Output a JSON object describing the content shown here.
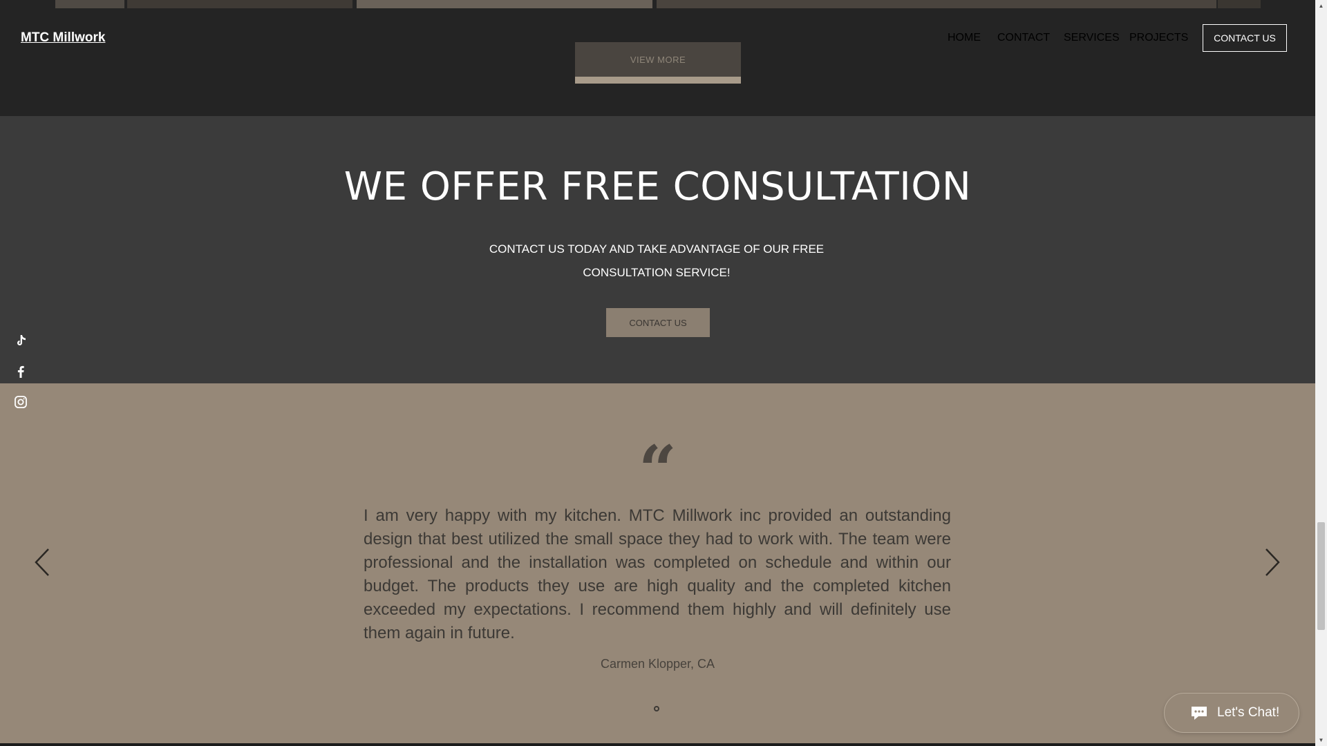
{
  "header": {
    "brand": "MTC Millwork",
    "nav": [
      "HOME",
      "CONTACT",
      "SERVICES",
      "PROJECTS"
    ],
    "cta": "CONTACT US"
  },
  "projects": {
    "view_more": "VIEW MORE"
  },
  "consultation": {
    "title": "WE OFFER FREE CONSULTATION",
    "subtitle_line1": "CONTACT US TODAY AND TAKE ADVANTAGE OF OUR FREE",
    "subtitle_line2": "CONSULTATION SERVICE!",
    "button": "CONTACT US"
  },
  "social": {
    "icons": [
      "tiktok-icon",
      "facebook-icon",
      "instagram-icon"
    ]
  },
  "testimonial": {
    "quote_mark": "“",
    "text": "I am very happy with my kitchen. MTC Millwork inc provided an outstanding design that best utilized the small space they had to work with. The team were professional and the installation was completed on schedule and within our budget. The products they use are high quality and the completed kitchen exceeded my expectations. I recommend them highly and will definitely use them again in future.",
    "author": "Carmen Klopper, CA"
  },
  "chat": {
    "label": "Let's Chat!"
  },
  "colors": {
    "dark": "#242424",
    "section_gray": "#3b3b3b",
    "taupe": "#968878",
    "button_taupe": "#8b7f71"
  }
}
